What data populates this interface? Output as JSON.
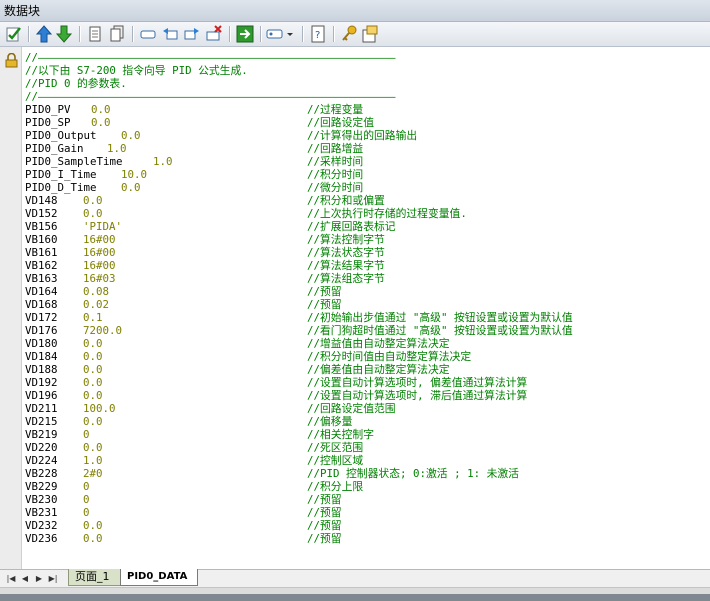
{
  "window": {
    "title": "数据块"
  },
  "toolbar": {
    "icons": [
      "check-icon",
      "arrow-up-icon",
      "arrow-down-icon",
      "page-icon",
      "pages-icon",
      "rect-icon",
      "undo-left-icon",
      "undo-right-icon",
      "delete-icon",
      "go-icon",
      "tag-dropdown-icon",
      "help-page-icon",
      "key-icon",
      "properties-icon"
    ]
  },
  "editor": {
    "header": [
      "//———————————————————————————————————————————————————————",
      "//以下由 S7-200 指令向导 PID 公式生成.",
      "//PID 0 的参数表.",
      "//———————————————————————————————————————————————————————"
    ],
    "rows": [
      {
        "name": "PID0_PV",
        "value": "0.0",
        "comment": "//过程变量"
      },
      {
        "name": "PID0_SP",
        "value": "0.0",
        "comment": "//回路设定值"
      },
      {
        "name": "PID0_Output",
        "value": "0.0",
        "comment": "//计算得出的回路输出"
      },
      {
        "name": "PID0_Gain",
        "value": "1.0",
        "comment": "//回路增益"
      },
      {
        "name": "PID0_SampleTime",
        "value": "1.0",
        "comment": "//采样时间"
      },
      {
        "name": "PID0_I_Time",
        "value": "10.0",
        "comment": "//积分时间"
      },
      {
        "name": "PID0_D_Time",
        "value": "0.0",
        "comment": "//微分时间"
      },
      {
        "name": "VD148",
        "value": "0.0",
        "comment": "//积分和或偏置"
      },
      {
        "name": "VD152",
        "value": "0.0",
        "comment": "//上次执行时存储的过程变量值."
      },
      {
        "name": "VB156",
        "value": "'PIDA'",
        "comment": "//扩展回路表标记"
      },
      {
        "name": "VB160",
        "value": "16#00",
        "comment": "//算法控制字节"
      },
      {
        "name": "VB161",
        "value": "16#00",
        "comment": "//算法状态字节"
      },
      {
        "name": "VB162",
        "value": "16#00",
        "comment": "//算法结果字节"
      },
      {
        "name": "VB163",
        "value": "16#03",
        "comment": "//算法组态字节"
      },
      {
        "name": "VD164",
        "value": "0.08",
        "comment": "//预留"
      },
      {
        "name": "VD168",
        "value": "0.02",
        "comment": "//预留"
      },
      {
        "name": "VD172",
        "value": "0.1",
        "comment": "//初始输出步值通过 \"高级\" 按钮设置或设置为默认值"
      },
      {
        "name": "VD176",
        "value": "7200.0",
        "comment": "//看门狗超时值通过 \"高级\" 按钮设置或设置为默认值"
      },
      {
        "name": "VD180",
        "value": "0.0",
        "comment": "//增益值由自动整定算法决定"
      },
      {
        "name": "VD184",
        "value": "0.0",
        "comment": "//积分时间值由自动整定算法决定"
      },
      {
        "name": "VD188",
        "value": "0.0",
        "comment": "//偏差值由自动整定算法决定"
      },
      {
        "name": "VD192",
        "value": "0.0",
        "comment": "//设置自动计算选项时, 偏差值通过算法计算"
      },
      {
        "name": "VD196",
        "value": "0.0",
        "comment": "//设置自动计算选项时, 滞后值通过算法计算"
      },
      {
        "name": "VD211",
        "value": "100.0",
        "comment": "//回路设定值范围"
      },
      {
        "name": "VD215",
        "value": "0.0",
        "comment": "//偏移量"
      },
      {
        "name": "VB219",
        "value": "0",
        "comment": "//相关控制字"
      },
      {
        "name": "VD220",
        "value": "0.0",
        "comment": "//死区范围"
      },
      {
        "name": "VD224",
        "value": "1.0",
        "comment": "//控制区域"
      },
      {
        "name": "VB228",
        "value": "2#0",
        "comment": "//PID 控制器状态; 0:激活 ; 1: 未激活"
      },
      {
        "name": "VB229",
        "value": "0",
        "comment": "//积分上限"
      },
      {
        "name": "VB230",
        "value": "0",
        "comment": "//预留"
      },
      {
        "name": "VB231",
        "value": "0",
        "comment": "//预留"
      },
      {
        "name": "VD232",
        "value": "0.0",
        "comment": "//预留"
      },
      {
        "name": "VD236",
        "value": "0.0",
        "comment": "//预留"
      }
    ]
  },
  "tabs": {
    "nav_icons": [
      "first-icon",
      "prev-icon",
      "next-icon",
      "last-icon"
    ],
    "items": [
      {
        "label": "页面_1",
        "active": false
      },
      {
        "label": "PID0_DATA",
        "active": true
      }
    ]
  }
}
